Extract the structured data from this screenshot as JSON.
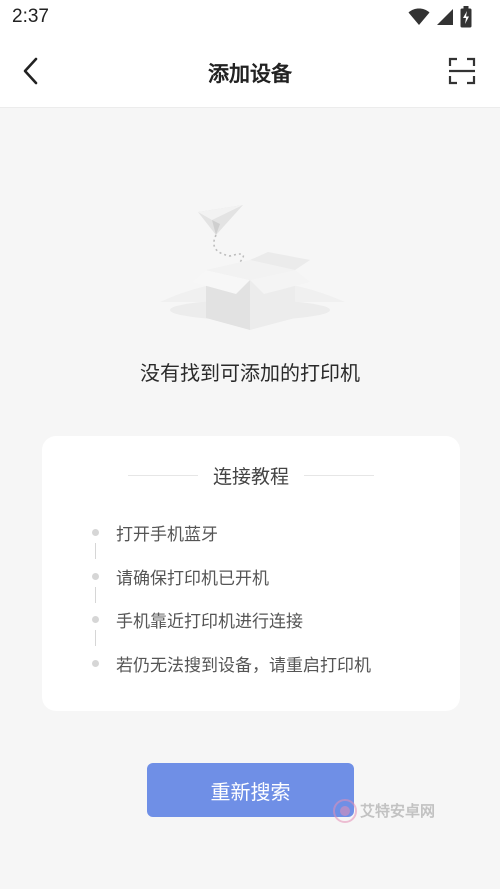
{
  "status_bar": {
    "time": "2:37",
    "icons": [
      "wifi-icon",
      "cellular-signal-icon",
      "battery-charging-icon"
    ]
  },
  "header": {
    "title": "添加设备",
    "back_icon": "chevron-left-icon",
    "scan_icon": "scan-icon"
  },
  "empty_state": {
    "illustration": "empty-box-with-paper-plane",
    "message": "没有找到可添加的打印机"
  },
  "tutorial": {
    "title": "连接教程",
    "steps": [
      "打开手机蓝牙",
      "请确保打印机已开机",
      "手机靠近打印机进行连接",
      "若仍无法搜到设备，请重启打印机"
    ]
  },
  "actions": {
    "research_label": "重新搜索"
  },
  "watermark": {
    "text": "艾特安卓网"
  },
  "colors": {
    "primary_button": "#6f8fe6",
    "background": "#f6f6f6",
    "card": "#ffffff"
  }
}
